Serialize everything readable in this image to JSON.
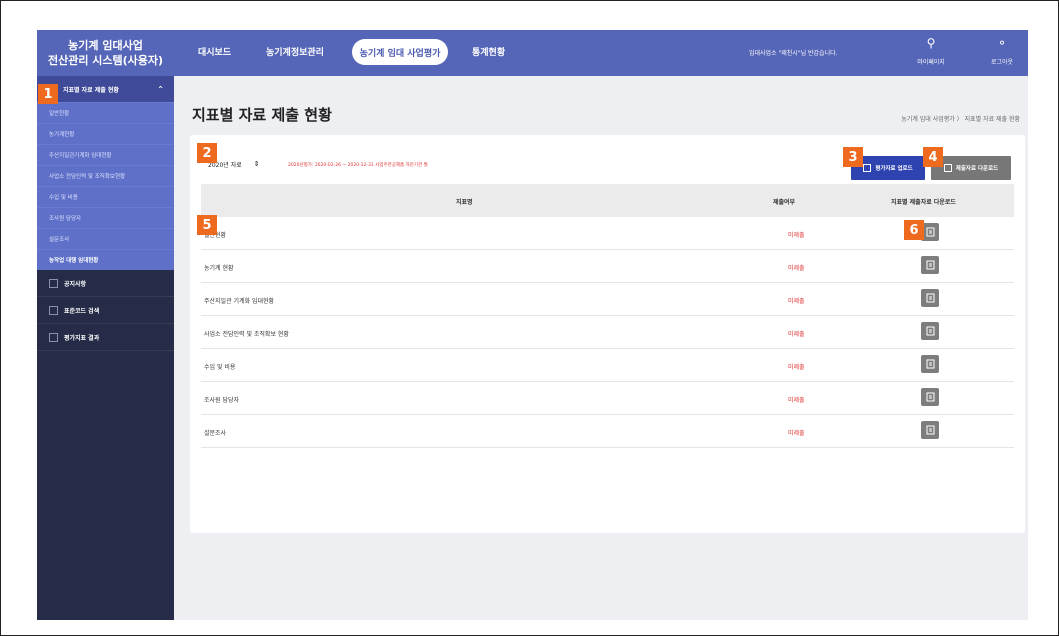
{
  "app": {
    "title_line1": "농기계 임대사업",
    "title_line2": "전산관리 시스템(사용자)"
  },
  "topnav": {
    "items": [
      "대시보드",
      "농기계정보관리"
    ],
    "active": "농기계 임대 사업평가",
    "after": "통계현황",
    "welcome": "임대사업소 \"제천시\"님 반갑습니다.",
    "mypage": "마이페이지",
    "logout": "로그아웃"
  },
  "sidebar": {
    "group_title": "지표별 자료 제출 현황",
    "sub_items": [
      "일반현황",
      "농기계현황",
      "주산지일관기계화 임대현황",
      "사업소 전담인력 및 조직확보현황",
      "수입 및 비용",
      "조사원 담당자",
      "설문조사",
      "농작업 대행 임대현황"
    ],
    "other_items": [
      "공지사항",
      "표준코드 검색",
      "평가지표 결과"
    ]
  },
  "page": {
    "title": "지표별 자료 제출 현황",
    "breadcrumb": "농기계 임대 사업평가 〉 지표별 자료 제출 현황",
    "year_select": "2020년 자료",
    "note": "2020년평가: 2020-02-26 ~ 2020-12-31 사업주관공제품 자문기관 월",
    "upload_btn": "평가자료 업로드",
    "download_btn": "제출자료 다운로드"
  },
  "table": {
    "headers": [
      "지표명",
      "제출여부",
      "지표별 제출자료 다운로드"
    ],
    "rows": [
      {
        "name": "일반현황",
        "status": "미제출"
      },
      {
        "name": "농기계 현황",
        "status": "미제출"
      },
      {
        "name": "주산지일관 기계화 임대현황",
        "status": "미제출"
      },
      {
        "name": "사업소 전담인력 및 조직확보 현황",
        "status": "미제출"
      },
      {
        "name": "수입 및 비용",
        "status": "미제출"
      },
      {
        "name": "조사원 담당자",
        "status": "미제출"
      },
      {
        "name": "설문조사",
        "status": "미제출"
      }
    ]
  },
  "badges": [
    "1",
    "2",
    "3",
    "4",
    "5",
    "6"
  ],
  "colors": {
    "accent": "#5565b7",
    "sidebar": "#262b47",
    "badge": "#ee6a1e",
    "status": "#dd3333"
  }
}
